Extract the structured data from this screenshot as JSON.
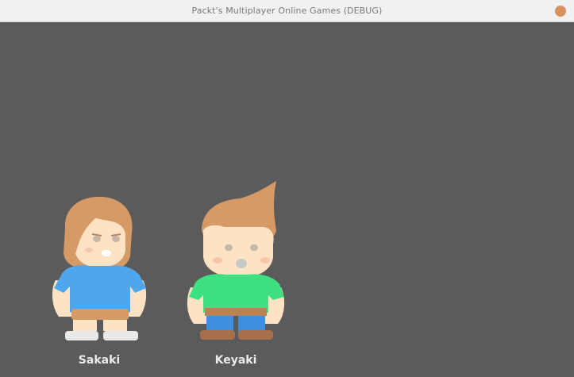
{
  "window": {
    "title": "Packt's Multiplayer Online Games (DEBUG)"
  },
  "colors": {
    "titlebar": "#f1f1f1",
    "viewport": "#5b5b5b",
    "close_button": "#d9925f",
    "skin": "#fde3c4",
    "hair": "#d59a66",
    "sakaki_shirt": "#4ea6ec",
    "keyaki_shirt": "#3fe07f",
    "keyaki_pants": "#3d8fe0",
    "belt": "#b58357",
    "shoes": "#a66f49"
  },
  "characters": [
    {
      "name": "Sakaki",
      "shirt": "blue-shirt",
      "hair": "bob-hair"
    },
    {
      "name": "Keyaki",
      "shirt": "green-shirt",
      "hair": "spiky-hair"
    }
  ]
}
